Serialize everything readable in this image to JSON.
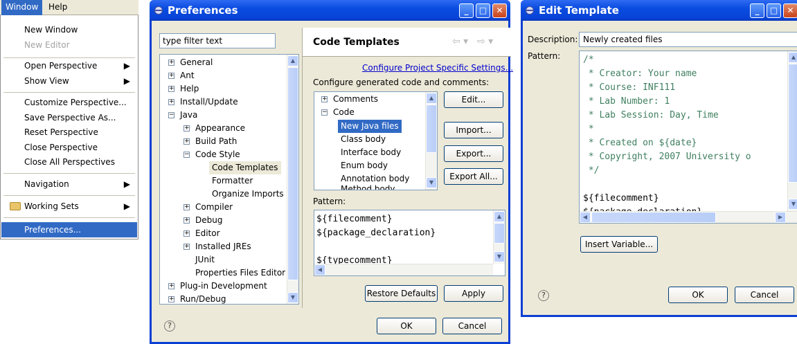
{
  "menu": {
    "bar": {
      "window": "Window",
      "help": "Help"
    },
    "items": [
      {
        "label": "New Window",
        "disabled": false
      },
      {
        "label": "New Editor",
        "disabled": true
      },
      {
        "label": "Open Perspective",
        "submenu": true
      },
      {
        "label": "Show View",
        "submenu": true
      },
      {
        "label": "Customize Perspective..."
      },
      {
        "label": "Save Perspective As..."
      },
      {
        "label": "Reset Perspective"
      },
      {
        "label": "Close Perspective"
      },
      {
        "label": "Close All Perspectives"
      },
      {
        "label": "Navigation",
        "submenu": true
      },
      {
        "label": "Working Sets",
        "submenu": true,
        "icon": "working-sets-icon"
      },
      {
        "label": "Preferences...",
        "selected": true
      }
    ]
  },
  "prefs": {
    "title": "Preferences",
    "filter_placeholder": "type filter text",
    "tree": [
      "General",
      "Ant",
      "Help",
      "Install/Update",
      "Java",
      "Appearance",
      "Build Path",
      "Code Style",
      "Code Templates",
      "Formatter",
      "Organize Imports",
      "Compiler",
      "Debug",
      "Editor",
      "Installed JREs",
      "JUnit",
      "Properties Files Editor",
      "Plug-in Development",
      "Run/Debug"
    ],
    "page_title": "Code Templates",
    "project_link": "Configure Project Specific Settings...",
    "configure_label": "Configure generated code and comments:",
    "templates_tree": [
      "Comments",
      "Code",
      "New Java files",
      "Class body",
      "Interface body",
      "Enum body",
      "Annotation body",
      "Method body"
    ],
    "edit": "Edit...",
    "import": "Import...",
    "export": "Export...",
    "export_all": "Export All...",
    "pattern_label": "Pattern:",
    "pattern_lines": [
      "${filecomment}",
      "${package_declaration}",
      "",
      "${typecomment}"
    ],
    "restore_defaults": "Restore Defaults",
    "apply": "Apply",
    "ok": "OK",
    "cancel": "Cancel",
    "help": "?"
  },
  "edit": {
    "title": "Edit Template",
    "description_label": "Description:",
    "description_value": "Newly created files",
    "pattern_label": "Pattern:",
    "pattern_lines": [
      "/*",
      " * Creator: Your name",
      " * Course: INF111",
      " * Lab Number: 1",
      " * Lab Session: Day, Time",
      " *",
      " * Created on ${date}",
      " * Copyright, 2007 University o",
      " */",
      "",
      "${filecomment}",
      "${package_declaration}"
    ],
    "insert_variable": "Insert Variable...",
    "ok": "OK",
    "cancel": "Cancel",
    "help": "?"
  }
}
